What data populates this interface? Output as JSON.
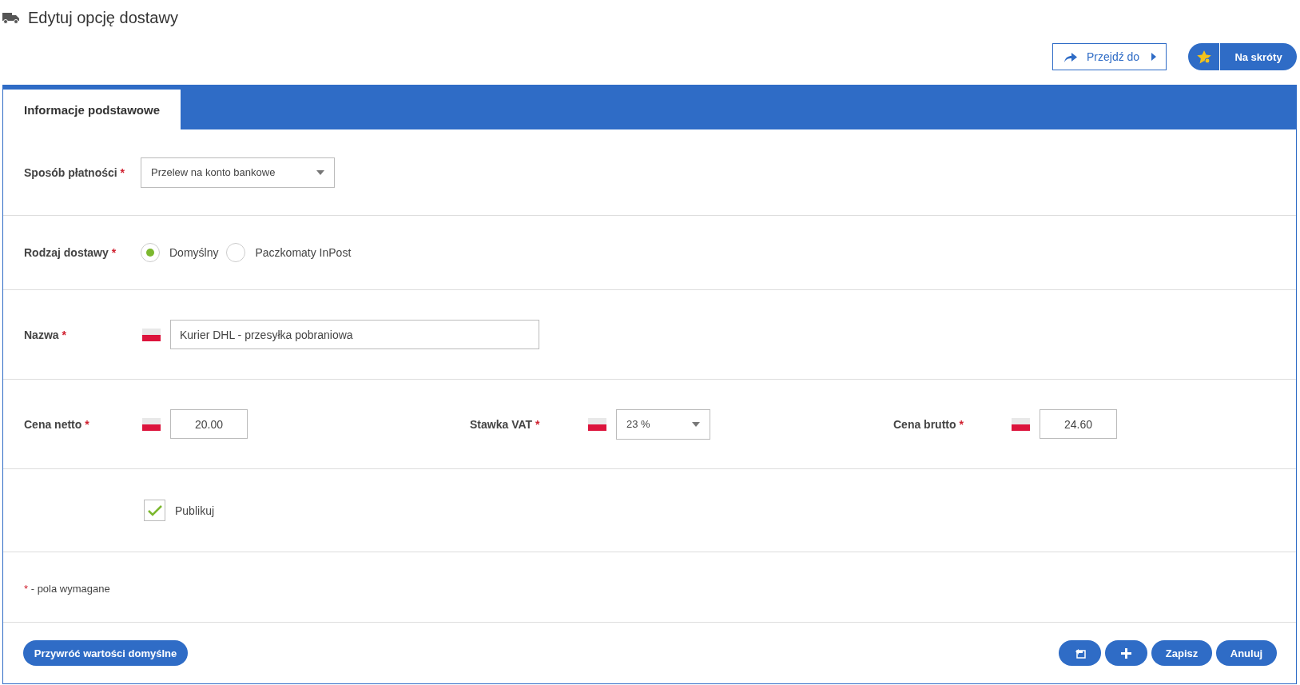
{
  "header": {
    "title": "Edytuj opcję dostawy"
  },
  "toolbar": {
    "goto": {
      "label": "Przejdź do"
    },
    "shortcuts": {
      "label": "Na skróty"
    }
  },
  "tabs": [
    {
      "label": "Informacje podstawowe",
      "selected": true
    }
  ],
  "payment": {
    "label": "Sposób płatności",
    "mark": "*",
    "value": "Przelew na konto bankowe"
  },
  "delivery_type": {
    "label": "Rodzaj dostawy",
    "mark": "*",
    "options": [
      {
        "label": "Domyślny",
        "selected": true
      },
      {
        "label": "Paczkomaty InPost",
        "selected": false
      }
    ]
  },
  "name": {
    "label": "Nazwa",
    "mark": "*",
    "value": "Kurier DHL - przesyłka pobraniowa"
  },
  "prices": [
    {
      "kind": "input",
      "label": "Cena netto",
      "mark": "*",
      "value": "20.00"
    },
    {
      "kind": "select",
      "label": "Stawka VAT",
      "mark": "*",
      "value": "23 %"
    },
    {
      "kind": "input",
      "label": "Cena brutto",
      "mark": "*",
      "value": "24.60"
    }
  ],
  "publish": {
    "label": "Publikuj",
    "checked": true
  },
  "note": {
    "mark": "*",
    "text": "- pola wymagane"
  },
  "footer": {
    "reset": "Przywróć wartości domyślne",
    "buttons": [
      {
        "kind": "back"
      },
      {
        "kind": "plus"
      },
      {
        "kind": "text",
        "label": "Zapisz"
      },
      {
        "kind": "text",
        "label": "Anuluj"
      }
    ]
  }
}
